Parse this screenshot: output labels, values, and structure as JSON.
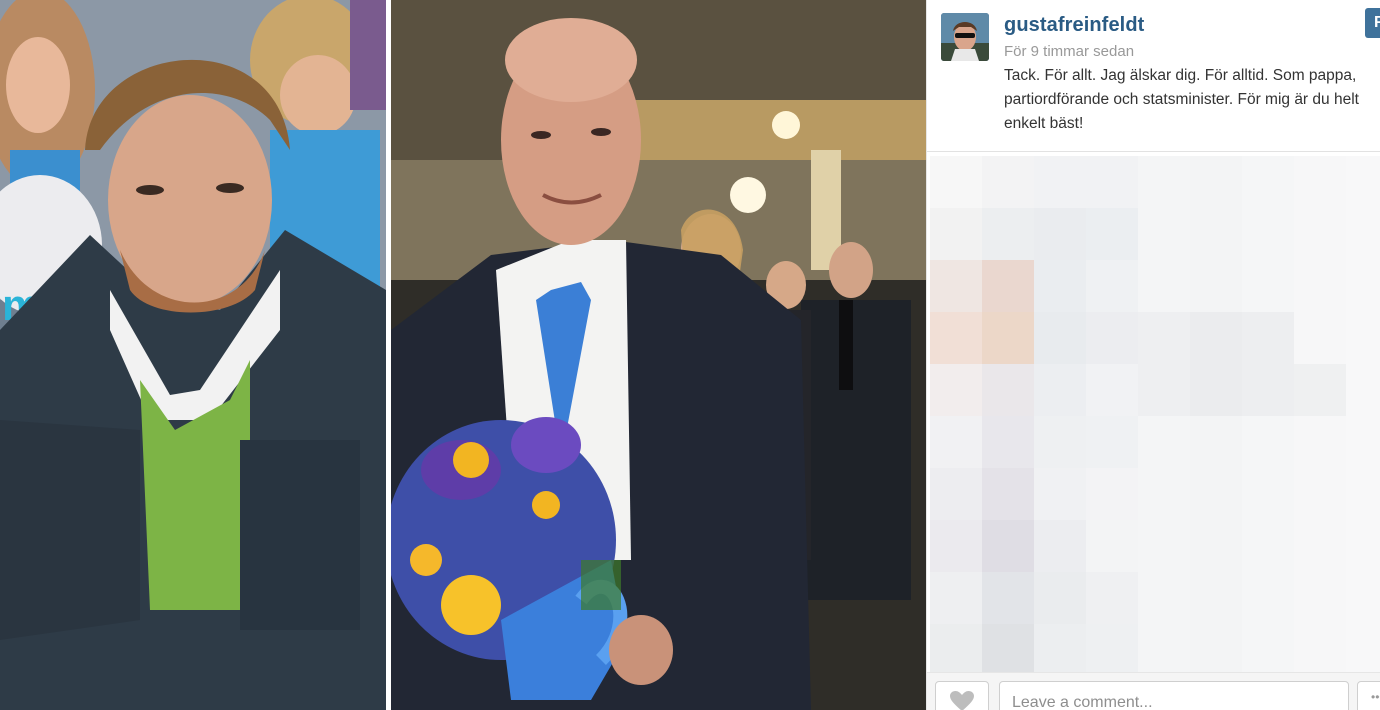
{
  "post": {
    "username": "gustafreinfeldt",
    "timestamp": "För 9 timmar sedan",
    "caption": "Tack. För allt. Jag älskar dig. För alltid. Som pappa,\npartiordförande och statsminister. För mig är du helt\nenkelt bäst!",
    "follow_label": "F"
  },
  "comment": {
    "placeholder": "Leave a comment..."
  },
  "more_label": "•••",
  "colors": {
    "username": "#2a5b84",
    "follow_button": "#3f729b",
    "timestamp": "#999999"
  },
  "icons": {
    "like": "heart-icon",
    "more": "ellipsis-icon"
  }
}
